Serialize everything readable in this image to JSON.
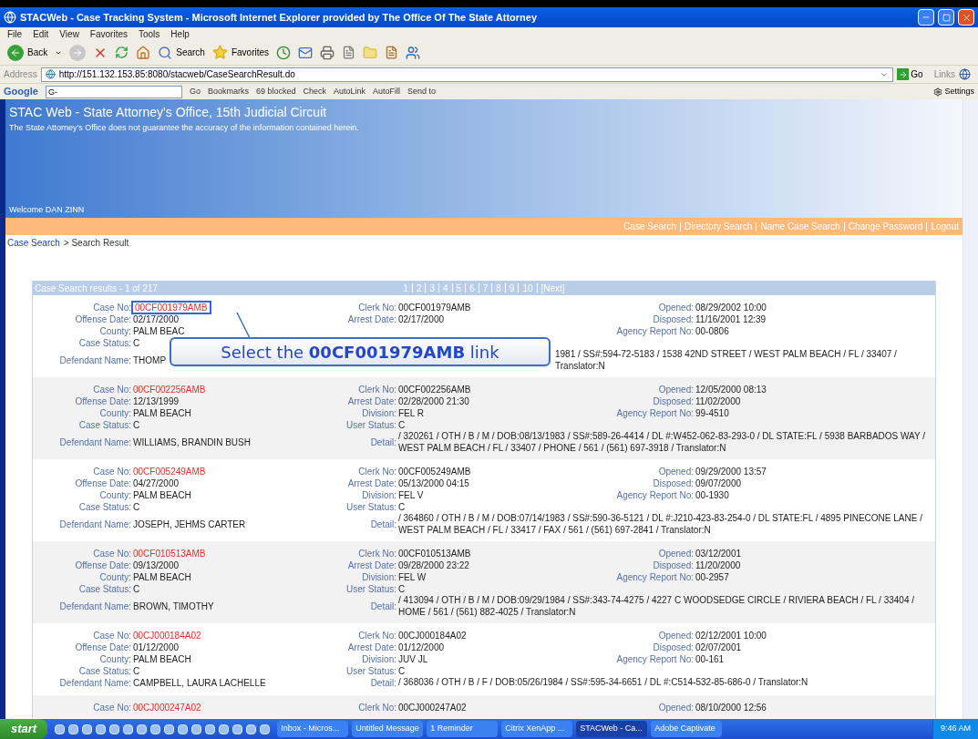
{
  "window": {
    "title": "STACWeb - Case Tracking System - Microsoft Internet Explorer provided by The Office Of The State Attorney"
  },
  "menu": [
    "File",
    "Edit",
    "View",
    "Favorites",
    "Tools",
    "Help"
  ],
  "toolbar": {
    "back": "Back",
    "search": "Search",
    "favorites": "Favorites"
  },
  "address": {
    "label": "Address",
    "url": "http://151.132.153.85:8080/stacweb/CaseSearchResult.do",
    "go": "Go",
    "links": "Links"
  },
  "google_bar": {
    "logo": "Google",
    "field": "G-",
    "items": [
      "Go",
      "Bookmarks",
      "69 blocked",
      "Check",
      "AutoLink",
      "AutoFill",
      "Send to"
    ],
    "settings": "Settings"
  },
  "banner": {
    "title": "STAC Web - State Attorney's Office, 15th Judicial Circuit",
    "disclaimer": "The State Attorney's Office does not guarantee the accuracy of the information contained herein.",
    "welcome": "Welcome DAN ZINN"
  },
  "nav": [
    "Case Search",
    "Directory Search",
    "Name Case Search",
    "Change Password",
    "Logout"
  ],
  "breadcrumb": {
    "link": "Case Search",
    "current": "> Search Result"
  },
  "results": {
    "title": "Case Search results - 1 of 217",
    "pages": [
      "1",
      "2",
      "3",
      "4",
      "5",
      "6",
      "7",
      "8",
      "9",
      "10",
      "[Next]"
    ],
    "records": [
      {
        "left": [
          {
            "label": "Case No:",
            "value": "00CF001979AMB",
            "kind": "link",
            "highlighted": true
          },
          {
            "label": "Offense Date:",
            "value": "02/17/2000"
          },
          {
            "label": "County:",
            "value": "PALM BEAC"
          },
          {
            "label": "Case Status:",
            "value": "C"
          }
        ],
        "middle": [
          {
            "label": "Clerk No:",
            "value": "00CF001979AMB"
          },
          {
            "label": "Arrest Date:",
            "value": "02/17/2000"
          }
        ],
        "right": [
          {
            "label": "Opened:",
            "value": "08/29/2002 10:00"
          },
          {
            "label": "Disposed:",
            "value": "11/16/2001 12:39"
          },
          {
            "label": "Agency Report No:",
            "value": "00-0806"
          }
        ],
        "defendant": {
          "label": "Defendant Name:",
          "value": "THOMP"
        },
        "detail": {
          "value": "1981 / SS#:594-72-5183 / 1538 42ND STREET / WEST PALM BEACH / FL / 33407 / Translator:N"
        }
      },
      {
        "left": [
          {
            "label": "Case No:",
            "value": "00CF002256AMB",
            "kind": "link",
            "highlighted": false
          },
          {
            "label": "Offense Date:",
            "value": "12/13/1999"
          },
          {
            "label": "County:",
            "value": "PALM BEACH"
          },
          {
            "label": "Case Status:",
            "value": "C"
          }
        ],
        "middle": [
          {
            "label": "Clerk No:",
            "value": "00CF002256AMB"
          },
          {
            "label": "Arrest Date:",
            "value": "02/28/2000 21:30"
          },
          {
            "label": "Division:",
            "value": "FEL R"
          },
          {
            "label": "User Status:",
            "value": "C"
          }
        ],
        "right": [
          {
            "label": "Opened:",
            "value": "12/05/2000 08:13"
          },
          {
            "label": "Disposed:",
            "value": "11/02/2000"
          },
          {
            "label": "Agency Report No:",
            "value": "99-4510"
          }
        ],
        "defendant": {
          "label": "Defendant Name:",
          "value": "WILLIAMS, BRANDIN BUSH"
        },
        "detail": {
          "label": "Detail:",
          "value": "/ 320261 / OTH / B / M / DOB:08/13/1983 / SS#:589-26-4414 / DL #:W452-062-83-293-0 / DL STATE:FL / 5938 BARBADOS WAY / WEST PALM BEACH / FL / 33407 / PHONE / 561 / (561) 697-3918 / Translator:N"
        }
      },
      {
        "left": [
          {
            "label": "Case No:",
            "value": "00CF005249AMB",
            "kind": "link",
            "highlighted": false
          },
          {
            "label": "Offense Date:",
            "value": "04/27/2000"
          },
          {
            "label": "County:",
            "value": "PALM BEACH"
          },
          {
            "label": "Case Status:",
            "value": "C"
          }
        ],
        "middle": [
          {
            "label": "Clerk No:",
            "value": "00CF005249AMB"
          },
          {
            "label": "Arrest Date:",
            "value": "05/13/2000 04:15"
          },
          {
            "label": "Division:",
            "value": "FEL V"
          },
          {
            "label": "User Status:",
            "value": "C"
          }
        ],
        "right": [
          {
            "label": "Opened:",
            "value": "09/29/2000 13:57"
          },
          {
            "label": "Disposed:",
            "value": "09/07/2000"
          },
          {
            "label": "Agency Report No:",
            "value": "00-1930"
          }
        ],
        "defendant": {
          "label": "Defendant Name:",
          "value": "JOSEPH, JEHMS CARTER"
        },
        "detail": {
          "label": "Detail:",
          "value": "/ 364860 / OTH / B / M / DOB:07/14/1983 / SS#:590-36-5121 / DL #:J210-423-83-254-0 / DL STATE:FL / 4895 PINECONE LANE / WEST PALM BEACH / FL / 33417 / FAX / 561 / (561) 697-2841 / Translator:N"
        }
      },
      {
        "left": [
          {
            "label": "Case No:",
            "value": "00CF010513AMB",
            "kind": "link",
            "highlighted": false
          },
          {
            "label": "Offense Date:",
            "value": "09/13/2000"
          },
          {
            "label": "County:",
            "value": "PALM BEACH"
          },
          {
            "label": "Case Status:",
            "value": "C"
          }
        ],
        "middle": [
          {
            "label": "Clerk No:",
            "value": "00CF010513AMB"
          },
          {
            "label": "Arrest Date:",
            "value": "09/28/2000 23:22"
          },
          {
            "label": "Division:",
            "value": "FEL W"
          },
          {
            "label": "User Status:",
            "value": "C"
          }
        ],
        "right": [
          {
            "label": "Opened:",
            "value": "03/12/2001"
          },
          {
            "label": "Disposed:",
            "value": "11/20/2000"
          },
          {
            "label": "Agency Report No:",
            "value": "00-2957"
          }
        ],
        "defendant": {
          "label": "Defendant Name:",
          "value": "BROWN, TIMOTHY"
        },
        "detail": {
          "label": "Detail:",
          "value": "/ 413094 / OTH / B / M / DOB:09/29/1984 / SS#:343-74-4275 / 4227 C WOODSEDGE CIRCLE / RIVIERA BEACH / FL / 33404 / HOME / 561 / (561) 882-4025 / Translator:N"
        }
      },
      {
        "left": [
          {
            "label": "Case No:",
            "value": "00CJ000184A02",
            "kind": "link",
            "highlighted": false
          },
          {
            "label": "Offense Date:",
            "value": "01/12/2000"
          },
          {
            "label": "County:",
            "value": "PALM BEACH"
          },
          {
            "label": "Case Status:",
            "value": "C"
          }
        ],
        "middle": [
          {
            "label": "Clerk No:",
            "value": "00CJ000184A02"
          },
          {
            "label": "Arrest Date:",
            "value": "01/12/2000"
          },
          {
            "label": "Division:",
            "value": "JUV JL"
          },
          {
            "label": "User Status:",
            "value": "C"
          }
        ],
        "right": [
          {
            "label": "Opened:",
            "value": "02/12/2001 10:00"
          },
          {
            "label": "Disposed:",
            "value": "02/07/2001"
          },
          {
            "label": "Agency Report No:",
            "value": "00-161"
          }
        ],
        "defendant": {
          "label": "Defendant Name:",
          "value": "CAMPBELL, LAURA LACHELLE"
        },
        "detail": {
          "label": "Detail:",
          "value": "/ 368036 / OTH / B / F / DOB:05/26/1984 / SS#:595-34-6651 / DL #:C514-532-85-686-0 / Translator:N"
        }
      },
      {
        "left": [
          {
            "label": "Case No:",
            "value": "00CJ000247A02",
            "kind": "link",
            "highlighted": false
          }
        ],
        "middle": [
          {
            "label": "Clerk No:",
            "value": "00CJ000247A02"
          }
        ],
        "right": [
          {
            "label": "Opened:",
            "value": "08/10/2000 12:56"
          }
        ]
      }
    ]
  },
  "callout": {
    "text": "Select the **00CF001979AMB** link"
  },
  "taskbar": {
    "start": "start",
    "tasks": [
      {
        "label": "Inbox - Micros...",
        "selected": false
      },
      {
        "label": "Untitled Message",
        "selected": false
      },
      {
        "label": "1 Reminder",
        "selected": false
      },
      {
        "label": "Citrix XenApp ...",
        "selected": false
      },
      {
        "label": "STACWeb - Ca...",
        "selected": true
      },
      {
        "label": "Adobe Captivate",
        "selected": false
      }
    ],
    "clock": "9:46 AM"
  }
}
